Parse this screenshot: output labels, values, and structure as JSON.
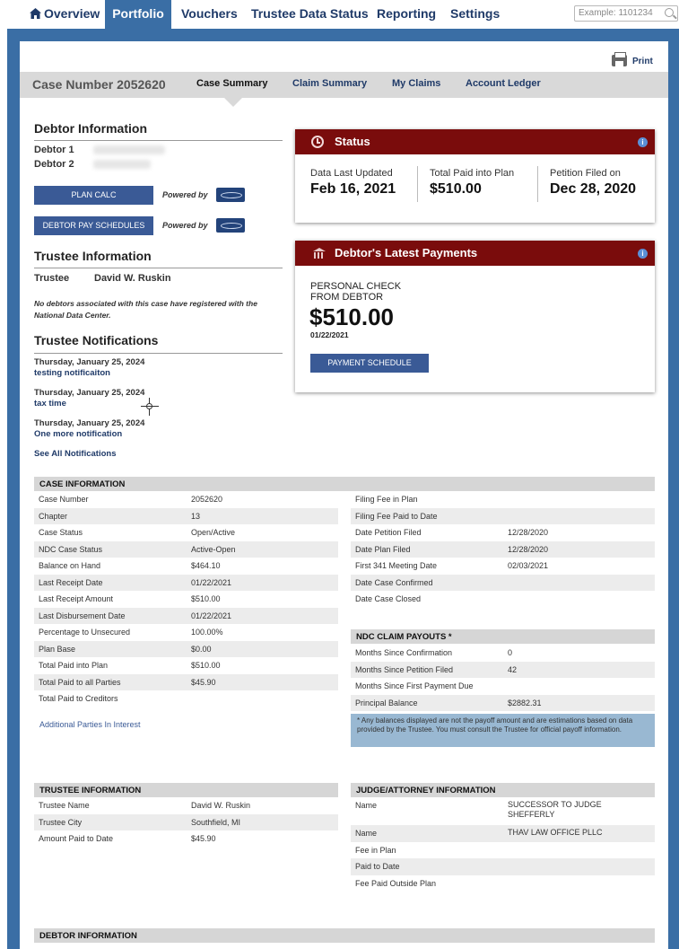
{
  "nav": {
    "items": [
      {
        "label": "Overview"
      },
      {
        "label": "Portfolio"
      },
      {
        "label": "Vouchers"
      },
      {
        "label": "Trustee Data Status"
      },
      {
        "label": "Reporting"
      },
      {
        "label": "Settings"
      }
    ],
    "active": "Portfolio",
    "search_placeholder": "Example: 1101234"
  },
  "print_label": "Print",
  "case_bar": {
    "title": "Case Number 2052620",
    "tabs": [
      {
        "label": "Case Summary"
      },
      {
        "label": "Claim Summary"
      },
      {
        "label": "My Claims"
      },
      {
        "label": "Account Ledger"
      }
    ],
    "selected": "Case Summary"
  },
  "debtor": {
    "heading": "Debtor Information",
    "debtor1_label": "Debtor 1",
    "debtor2_label": "Debtor 2",
    "plan_calc_button": "PLAN CALC",
    "pay_schedules_button": "DEBTOR PAY SCHEDULES",
    "powered_by": "Powered by"
  },
  "trustee": {
    "heading": "Trustee Information",
    "label": "Trustee",
    "name": "David W. Ruskin",
    "note": "No debtors associated with this case have registered with the National Data Center."
  },
  "notifications": {
    "heading": "Trustee Notifications",
    "items": [
      {
        "date": "Thursday, January 25, 2024",
        "text": "testing notificaiton"
      },
      {
        "date": "Thursday, January 25, 2024",
        "text": "tax time"
      },
      {
        "date": "Thursday, January 25, 2024",
        "text": "One more notification"
      }
    ],
    "see_all": "See All Notifications"
  },
  "status_card": {
    "title": "Status",
    "stats": [
      {
        "label": "Data Last Updated",
        "value": "Feb 16, 2021"
      },
      {
        "label": "Total Paid into Plan",
        "value": "$510.00"
      },
      {
        "label": "Petition Filed on",
        "value": "Dec 28, 2020"
      }
    ],
    "info_glyph": "i"
  },
  "payments_card": {
    "title": "Debtor's Latest Payments",
    "method_line1": "PERSONAL CHECK",
    "method_line2": "FROM DEBTOR",
    "amount": "$510.00",
    "date": "01/22/2021",
    "button": "PAYMENT SCHEDULE",
    "info_glyph": "i"
  },
  "case_information": {
    "heading": "CASE INFORMATION",
    "left_rows": [
      {
        "k": "Case Number",
        "v": "2052620"
      },
      {
        "k": "Chapter",
        "v": "13"
      },
      {
        "k": "Case Status",
        "v": "Open/Active"
      },
      {
        "k": "NDC Case Status",
        "v": "Active-Open"
      },
      {
        "k": "Balance on Hand",
        "v": "$464.10"
      },
      {
        "k": "Last Receipt Date",
        "v": "01/22/2021"
      },
      {
        "k": "Last Receipt Amount",
        "v": "$510.00"
      },
      {
        "k": "Last Disbursement Date",
        "v": "01/22/2021"
      },
      {
        "k": "Percentage to Unsecured",
        "v": "100.00%"
      },
      {
        "k": "Plan Base",
        "v": "$0.00"
      },
      {
        "k": "Total Paid into Plan",
        "v": "$510.00"
      },
      {
        "k": "Total Paid to all Parties",
        "v": "$45.90"
      },
      {
        "k": "Total Paid to Creditors",
        "v": ""
      }
    ],
    "right_rows": [
      {
        "k": "Filing Fee in Plan",
        "v": ""
      },
      {
        "k": "Filing Fee Paid to Date",
        "v": ""
      },
      {
        "k": "Date Petition Filed",
        "v": "12/28/2020"
      },
      {
        "k": "Date Plan Filed",
        "v": "12/28/2020"
      },
      {
        "k": "First 341 Meeting Date",
        "v": "02/03/2021"
      },
      {
        "k": "Date Case Confirmed",
        "v": ""
      },
      {
        "k": "Date Case Closed",
        "v": ""
      }
    ],
    "additional_parties_link": "Additional Parties In Interest"
  },
  "ndc_claim_payouts": {
    "heading": "NDC CLAIM PAYOUTS *",
    "rows": [
      {
        "k": "Months Since Confirmation",
        "v": "0"
      },
      {
        "k": "Months Since Petition Filed",
        "v": "42"
      },
      {
        "k": "Months Since First Payment Due",
        "v": ""
      },
      {
        "k": "Principal Balance",
        "v": "$2882.31"
      }
    ],
    "note": "* Any balances displayed are not the payoff amount and are estimations based on data provided by the Trustee. You must consult the Trustee for official payoff information."
  },
  "trustee_information_table": {
    "heading": "TRUSTEE INFORMATION",
    "rows": [
      {
        "k": "Trustee Name",
        "v": "David W. Ruskin"
      },
      {
        "k": "Trustee City",
        "v": "Southfield, MI"
      },
      {
        "k": "Amount Paid to Date",
        "v": "$45.90"
      }
    ]
  },
  "judge_attorney_information": {
    "heading": "JUDGE/ATTORNEY INFORMATION",
    "rows": [
      {
        "k": "Name",
        "v": "SUCCESSOR TO JUDGE SHEFFERLY"
      },
      {
        "k": "Name",
        "v": "THAV LAW OFFICE PLLC"
      },
      {
        "k": "Fee in Plan",
        "v": ""
      },
      {
        "k": "Paid to Date",
        "v": ""
      },
      {
        "k": "Fee Paid Outside Plan",
        "v": ""
      }
    ]
  },
  "debtor_information_table": {
    "heading": "DEBTOR INFORMATION"
  },
  "colors": {
    "nav_active": "#3a6ea5",
    "card_header": "#7a0c0c",
    "button": "#3a5a96",
    "link": "#1f3a68",
    "note_bg": "#99b8d2"
  }
}
